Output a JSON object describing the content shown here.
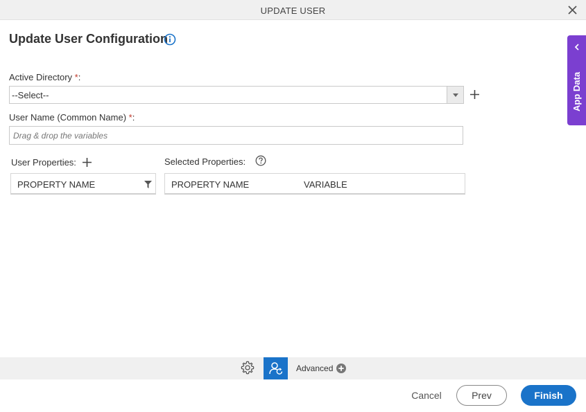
{
  "dialog": {
    "title": "UPDATE USER"
  },
  "page": {
    "heading": "Update User Configuration"
  },
  "form": {
    "active_directory": {
      "label": "Active Directory",
      "required_mark": "*",
      "colon": ":",
      "selected": "--Select--"
    },
    "user_name": {
      "label": "User Name (Common Name)",
      "required_mark": "*",
      "colon": ":",
      "placeholder": "Drag & drop the variables",
      "value": ""
    }
  },
  "user_properties": {
    "label": "User Properties:",
    "column": "PROPERTY NAME"
  },
  "selected_properties": {
    "label": "Selected Properties:",
    "columns": [
      "PROPERTY NAME",
      "VARIABLE"
    ]
  },
  "toolbar": {
    "advanced_label": "Advanced"
  },
  "footer": {
    "cancel": "Cancel",
    "prev": "Prev",
    "finish": "Finish"
  },
  "side_panel": {
    "label": "App Data"
  },
  "icons": {
    "close": "close-icon",
    "info": "info-icon",
    "add": "plus-icon",
    "filter": "filter-icon",
    "help": "question-circle-icon",
    "settings": "gear-icon",
    "user": "user-sync-icon",
    "advanced_add": "plus-circle-icon",
    "collapse": "chevron-left-icon"
  },
  "colors": {
    "primary": "#1a73c9",
    "side_panel": "#7b3fd0",
    "required": "#c0392b"
  }
}
